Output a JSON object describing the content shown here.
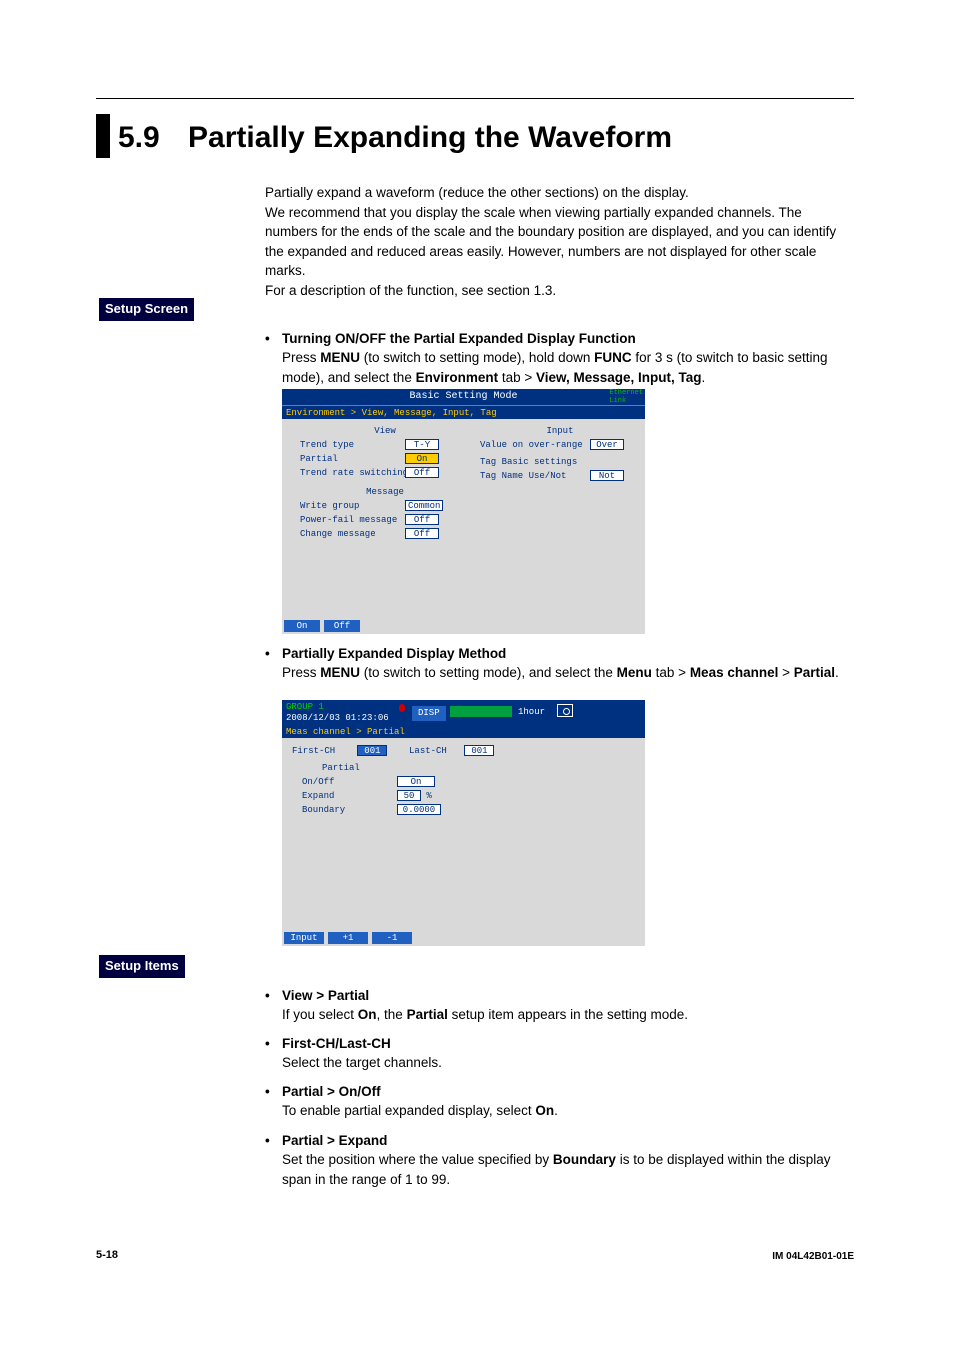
{
  "section": {
    "number": "5.9",
    "title": "Partially Expanding the Waveform"
  },
  "intro": "Partially expand a waveform (reduce the other sections) on the display.\nWe recommend that you display the scale when viewing partially expanded channels. The numbers for the ends of the scale and the boundary position are displayed, and you can identify the expanded and reduced areas easily. However, numbers are not displayed for other scale marks.\nFor a description of the function, see section 1.3.",
  "badges": {
    "setup_screen": "Setup Screen",
    "setup_items": "Setup Items"
  },
  "bullet1": {
    "title": "Turning ON/OFF the Partial Expanded Display Function",
    "body_pre": "Press ",
    "menu": "MENU",
    "body_mid1": " (to switch to setting mode), hold down ",
    "func": "FUNC",
    "body_mid2": " for 3 s (to switch to basic setting mode), and select the ",
    "env": "Environment",
    "body_mid3": " tab > ",
    "path": "View, Message, Input, Tag",
    "body_end": "."
  },
  "shot1": {
    "title": "Basic Setting Mode",
    "eth": "Ethernet\nLink",
    "breadcrumb": "Environment > View, Message, Input, Tag",
    "view_hdr": "View",
    "trend_type_lab": "Trend type",
    "trend_type_val": "T-Y",
    "partial_lab": "Partial",
    "partial_val": "On",
    "trs_lab": "Trend rate switching",
    "trs_val": "Off",
    "msg_hdr": "Message",
    "wg_lab": "Write group",
    "wg_val": "Common",
    "pf_lab": "Power-fail message",
    "pf_val": "Off",
    "cm_lab": "Change message",
    "cm_val": "Off",
    "input_hdr": "Input",
    "vor_lab": "Value on over-range",
    "vor_val": "Over",
    "tag_hdr": "Tag Basic settings",
    "tnu_lab": "Tag Name Use/Not",
    "tnu_val": "Not",
    "btn_on": "On",
    "btn_off": "Off"
  },
  "bullet2": {
    "title": "Partially Expanded Display Method",
    "body_pre": "Press ",
    "menu": "MENU",
    "body_mid1": " (to switch to setting mode), and select the ",
    "menutab": "Menu",
    "body_mid2": " tab > ",
    "meas": "Meas channel",
    "body_mid3": " > ",
    "partial": "Partial",
    "body_end": "."
  },
  "shot2": {
    "group": "GROUP 1",
    "timestamp": "2008/12/03 01:23:06",
    "disp": "DISP",
    "hour": "1hour",
    "breadcrumb": "Meas channel > Partial",
    "first_lab": "First-CH",
    "first_val": "001",
    "last_lab": "Last-CH",
    "last_val": "001",
    "sect": "Partial",
    "onoff_lab": "On/Off",
    "onoff_val": "On",
    "exp_lab": "Expand",
    "exp_val": "50",
    "exp_unit": "%",
    "bnd_lab": "Boundary",
    "bnd_val": "0.0000",
    "btn_input": "Input",
    "btn_plus": "+1",
    "btn_minus": "-1"
  },
  "items": {
    "i1": {
      "title": "View > Partial",
      "pre": "If you select ",
      "b1": "On",
      "mid": ", the ",
      "b2": "Partial",
      "post": " setup item appears in the setting mode."
    },
    "i2": {
      "title": "First-CH/Last-CH",
      "body": "Select the target channels."
    },
    "i3": {
      "title": "Partial > On/Off",
      "pre": "To enable partial expanded display, select ",
      "b1": "On",
      "post": "."
    },
    "i4": {
      "title": "Partial > Expand",
      "pre": "Set the position where the value specified by ",
      "b1": "Boundary",
      "post": " is to be displayed within the display span in the range of 1 to 99."
    }
  },
  "footer": {
    "page": "5-18",
    "docid": "IM 04L42B01-01E"
  }
}
